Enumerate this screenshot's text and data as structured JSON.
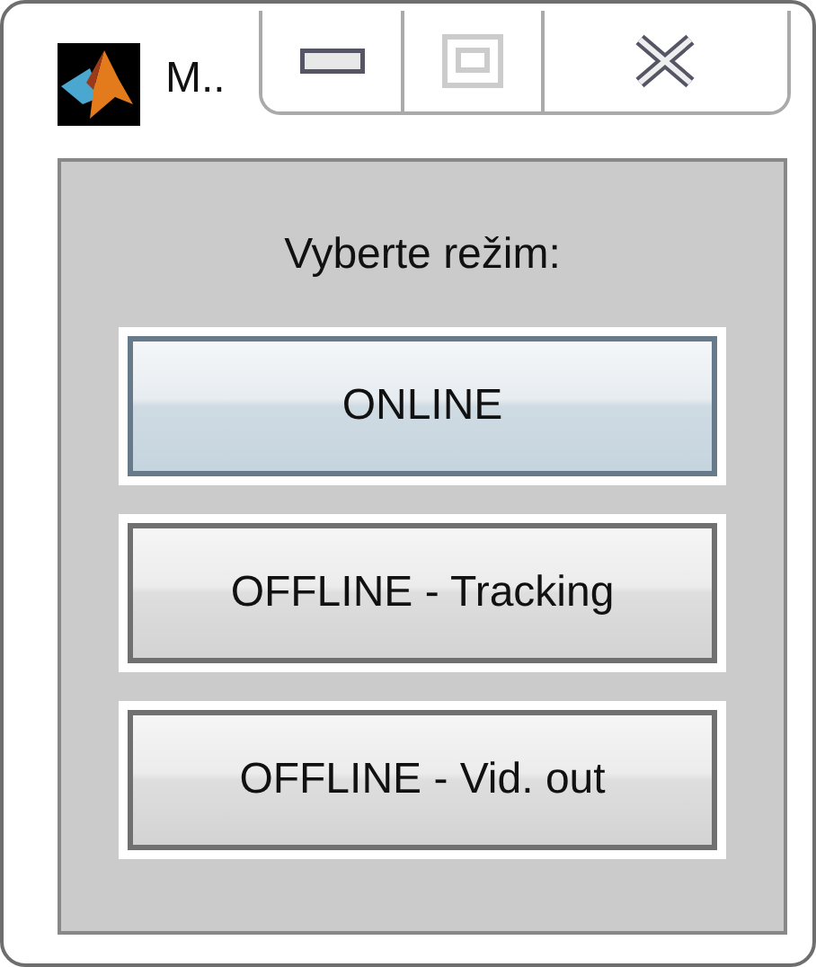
{
  "window": {
    "title": "M.."
  },
  "panel": {
    "label": "Vyberte režim:",
    "buttons": [
      {
        "label": "ONLINE",
        "focused": true
      },
      {
        "label": "OFFLINE - Tracking",
        "focused": false
      },
      {
        "label": "OFFLINE - Vid. out",
        "focused": false
      }
    ]
  }
}
